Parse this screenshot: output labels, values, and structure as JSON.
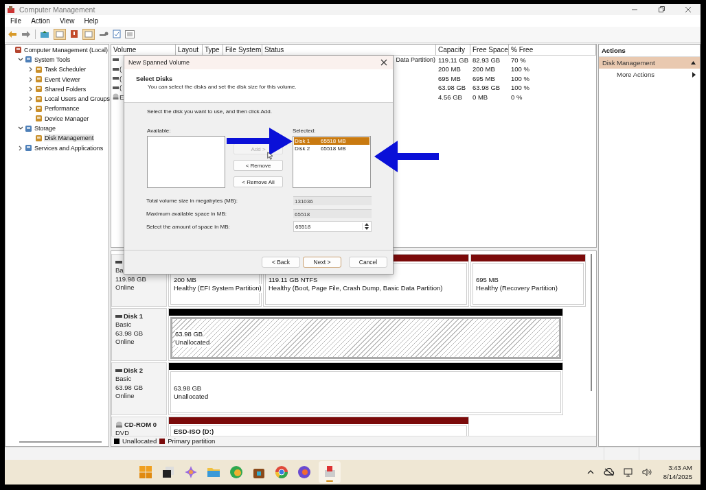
{
  "window": {
    "title": "Computer Management"
  },
  "menu": [
    "File",
    "Action",
    "View",
    "Help"
  ],
  "tree": [
    {
      "label": "Computer Management (Local)",
      "selected": false,
      "children": [
        {
          "label": "System Tools",
          "expanded": true,
          "selected": false,
          "children": [
            {
              "label": "Task Scheduler",
              "expanded": false,
              "selected": false
            },
            {
              "label": "Event Viewer",
              "expanded": false,
              "selected": false
            },
            {
              "label": "Shared Folders",
              "expanded": false,
              "selected": false
            },
            {
              "label": "Local Users and Groups",
              "expanded": false,
              "selected": false
            },
            {
              "label": "Performance",
              "expanded": false,
              "selected": false
            },
            {
              "label": "Device Manager",
              "selected": false
            }
          ]
        },
        {
          "label": "Storage",
          "expanded": true,
          "selected": false,
          "children": [
            {
              "label": "Disk Management",
              "selected": true
            }
          ]
        },
        {
          "label": "Services and Applications",
          "expanded": false,
          "selected": false
        }
      ]
    }
  ],
  "volume_table": {
    "columns": [
      "Volume",
      "Layout",
      "Type",
      "File System",
      "Status",
      "Capacity",
      "Free Space",
      "% Free"
    ],
    "rows": [
      {
        "kind": "disk",
        "status": "Data Partition)",
        "capacity": "119.11 GB",
        "free_space": "82.93 GB",
        "percent_free": "70 %"
      },
      {
        "kind": "disk",
        "volume": "(",
        "capacity": "200 MB",
        "free_space": "200 MB",
        "percent_free": "100 %"
      },
      {
        "kind": "disk",
        "volume": "(",
        "capacity": "695 MB",
        "free_space": "695 MB",
        "percent_free": "100 %"
      },
      {
        "kind": "disk",
        "volume": "(",
        "capacity": "63.98 GB",
        "free_space": "63.98 GB",
        "percent_free": "100 %"
      },
      {
        "kind": "cdrom",
        "volume": "E",
        "capacity": "4.56 GB",
        "free_space": "0 MB",
        "percent_free": "0 %"
      }
    ]
  },
  "disks": [
    {
      "kind": "disk",
      "type": "Ba",
      "size": "119.98 GB",
      "status": "Online",
      "partitions": [
        {
          "kind": "primary",
          "selected": false,
          "size": "200 MB",
          "status": "Healthy (EFI System Partition)"
        },
        {
          "kind": "primary",
          "selected": false,
          "size": "119.11 GB NTFS",
          "status": "Healthy (Boot, Page File, Crash Dump, Basic Data Partition)"
        },
        {
          "kind": "primary",
          "selected": false,
          "size": "695 MB",
          "status": "Healthy (Recovery Partition)"
        }
      ]
    },
    {
      "kind": "disk",
      "name": "Disk 1",
      "type": "Basic",
      "size": "63.98 GB",
      "status": "Online",
      "partitions": [
        {
          "kind": "unallocated",
          "selected": true,
          "size": "63.98 GB",
          "status": "Unallocated"
        }
      ]
    },
    {
      "kind": "disk",
      "name": "Disk 2",
      "type": "Basic",
      "size": "63.98 GB",
      "status": "Online",
      "partitions": [
        {
          "kind": "unallocated",
          "selected": false,
          "size": "63.98 GB",
          "status": "Unallocated"
        }
      ]
    },
    {
      "kind": "cdrom",
      "name": "CD-ROM 0",
      "type": "DVD",
      "partitions": [
        {
          "kind": "primary",
          "selected": false,
          "label": "ESD-ISO  (D:)"
        }
      ]
    }
  ],
  "legend": [
    {
      "label": "Unallocated",
      "color": "#000000"
    },
    {
      "label": "Primary partition",
      "color": "#7b0a0a"
    }
  ],
  "actions": {
    "title": "Actions",
    "items": [
      {
        "label": "Disk Management",
        "kind": "section"
      },
      {
        "label": "More Actions",
        "kind": "submenu"
      }
    ]
  },
  "dialog": {
    "title": "New Spanned Volume",
    "heading": "Select Disks",
    "subheading": "You can select the disks and set the disk size for this volume.",
    "instruction": "Select the disk you want to use, and then click Add.",
    "available_label": "Available:",
    "move_buttons": [
      {
        "label": "Add >",
        "disabled": true
      },
      {
        "label": "< Remove",
        "disabled": false
      },
      {
        "label": "< Remove All",
        "disabled": false
      }
    ],
    "selected_label": "Selected:",
    "selected_items": [
      {
        "disk": "Disk 1",
        "size": "65518 MB",
        "selected": true
      },
      {
        "disk": "Disk 2",
        "size": "65518 MB",
        "selected": false
      }
    ],
    "fields": [
      {
        "label": "Total volume size in megabytes (MB):",
        "value": "131036",
        "kind": "readonly"
      },
      {
        "label": "Maximum available space in MB:",
        "value": "65518",
        "kind": "readonly"
      },
      {
        "label": "Select the amount of space in MB:",
        "value": "65518",
        "kind": "spinner"
      }
    ],
    "buttons": [
      {
        "label": "< Back",
        "default": false
      },
      {
        "label": "Next >",
        "default": true
      },
      {
        "label": "Cancel",
        "default": false
      }
    ]
  },
  "clock": {
    "time": "3:43 AM",
    "date": "8/14/2025"
  }
}
